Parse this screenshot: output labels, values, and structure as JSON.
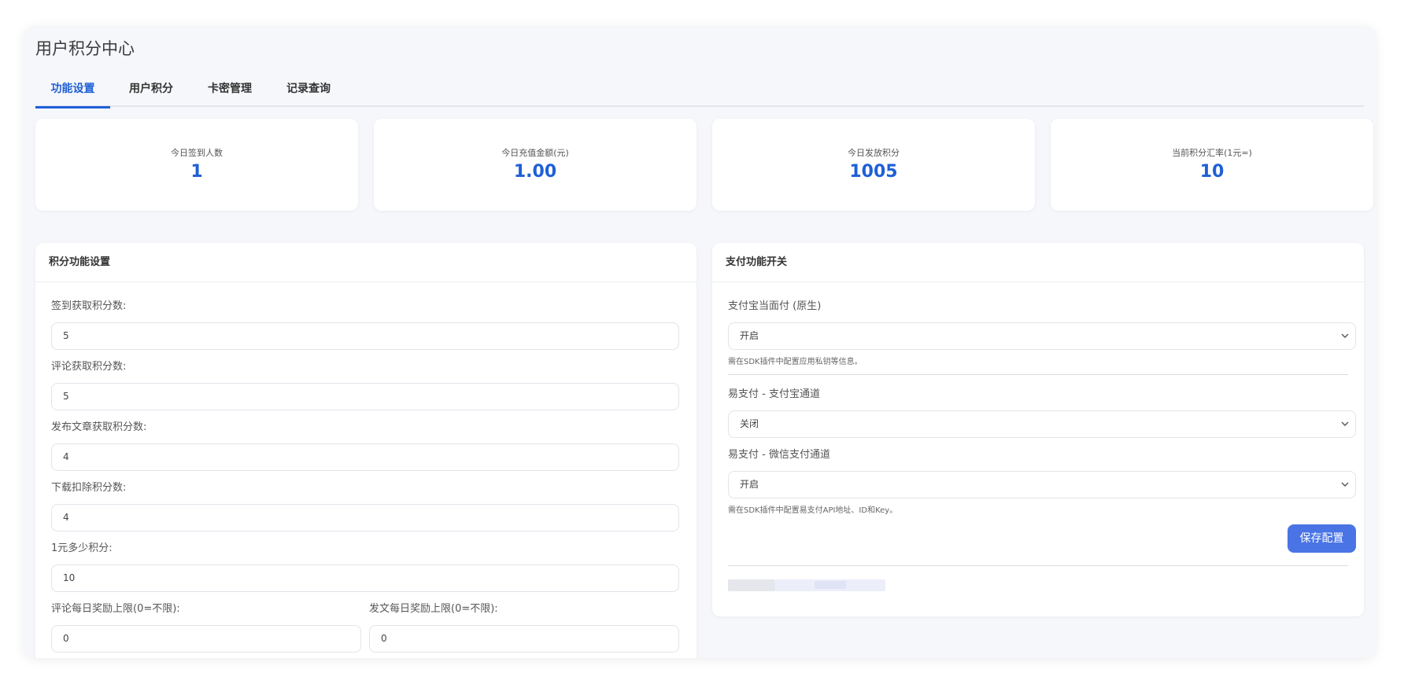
{
  "page": {
    "title": "用户积分中心"
  },
  "tabs": [
    {
      "label": "功能设置",
      "active": true
    },
    {
      "label": "用户积分",
      "active": false
    },
    {
      "label": "卡密管理",
      "active": false
    },
    {
      "label": "记录查询",
      "active": false
    }
  ],
  "stats": [
    {
      "label": "今日签到人数",
      "value": "1"
    },
    {
      "label": "今日充值金额(元)",
      "value": "1.00"
    },
    {
      "label": "今日发放积分",
      "value": "1005"
    },
    {
      "label": "当前积分汇率(1元=)",
      "value": "10"
    }
  ],
  "points_settings": {
    "title": "积分功能设置",
    "fields": [
      {
        "label": "签到获取积分数:",
        "value": "5"
      },
      {
        "label": "评论获取积分数:",
        "value": "5"
      },
      {
        "label": "发布文章获取积分数:",
        "value": "4"
      },
      {
        "label": "下载扣除积分数:",
        "value": "4"
      },
      {
        "label": "1元多少积分:",
        "value": "10"
      }
    ],
    "limits": [
      {
        "label": "评论每日奖励上限(0=不限):",
        "value": "0"
      },
      {
        "label": "发文每日奖励上限(0=不限):",
        "value": "0"
      }
    ]
  },
  "payment_settings": {
    "title": "支付功能开关",
    "options": [
      {
        "label": "支付宝当面付 (原生)",
        "value": "开启",
        "hint": "需在SDK插件中配置应用私钥等信息。"
      },
      {
        "label": "易支付 - 支付宝通道",
        "value": "关闭",
        "hint": ""
      },
      {
        "label": "易支付 - 微信支付通道",
        "value": "开启",
        "hint": "需在SDK插件中配置易支付API地址、ID和Key。"
      }
    ],
    "save_label": "保存配置"
  },
  "colors": {
    "accent": "#1f5fd6",
    "button": "#4a74e5",
    "background": "#f6f7fb"
  },
  "icons": {
    "select_arrow": "chevron-down-icon"
  }
}
